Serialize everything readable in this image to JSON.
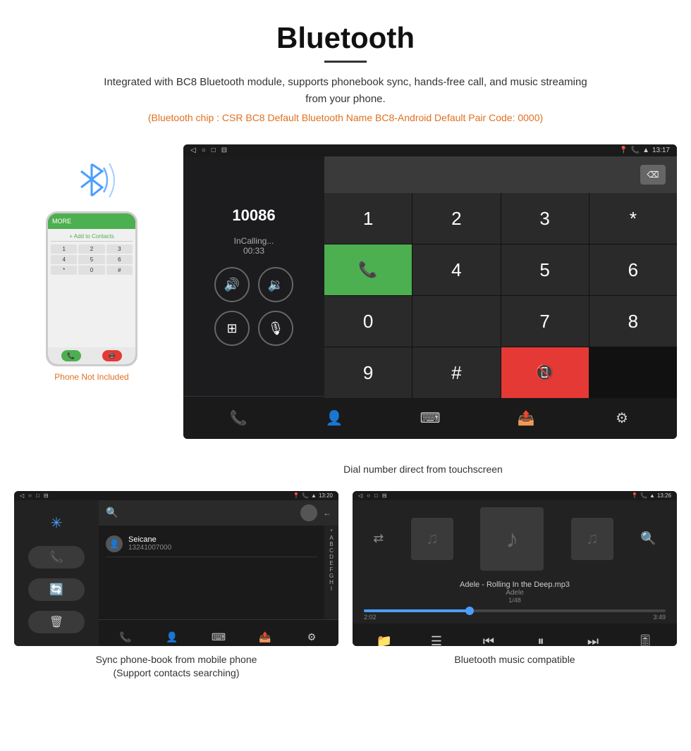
{
  "header": {
    "title": "Bluetooth",
    "description": "Integrated with BC8 Bluetooth module, supports phonebook sync, hands-free call, and music streaming from your phone.",
    "orange_info": "(Bluetooth chip : CSR BC8    Default Bluetooth Name BC8-Android    Default Pair Code: 0000)"
  },
  "phone_area": {
    "not_included_label": "Phone Not Included"
  },
  "dialer_screen": {
    "status_time": "13:17",
    "dial_number": "10086",
    "call_status": "InCalling...",
    "call_timer": "00:33",
    "keypad_keys": [
      "1",
      "2",
      "3",
      "*",
      "4",
      "5",
      "6",
      "0",
      "7",
      "8",
      "9",
      "#"
    ]
  },
  "dialer_caption": "Dial number direct from touchscreen",
  "phonebook_screen": {
    "status_time": "13:20",
    "contact_name": "Seicane",
    "contact_phone": "13241007000",
    "alphabet_index": [
      "*",
      "A",
      "B",
      "C",
      "D",
      "E",
      "F",
      "G",
      "H",
      "I"
    ]
  },
  "phonebook_caption_line1": "Sync phone-book from mobile phone",
  "phonebook_caption_line2": "(Support contacts searching)",
  "music_screen": {
    "status_time": "13:26",
    "song_title": "Adele - Rolling In the Deep.mp3",
    "artist": "Adele",
    "track_info": "1/48",
    "current_time": "2:02",
    "total_time": "3:49",
    "progress_percent": 35
  },
  "music_caption": "Bluetooth music compatible"
}
